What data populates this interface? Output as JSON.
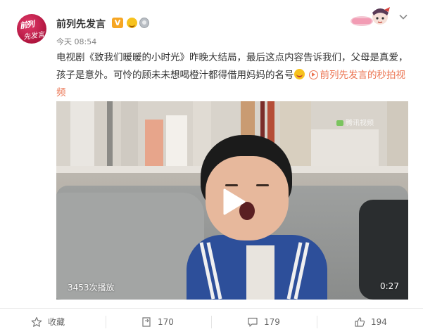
{
  "post": {
    "username": "前列先发言",
    "verified_badge": "V",
    "time": "今天 08:54",
    "text_before_link": "电视剧《致我们暖暖的小时光》昨晚大结局，最后这点内容告诉我们，父母是真爱，孩子是意外。可怜的顾未未想喝橙汁都得借用妈妈的名号",
    "video_link_label": "前列先发言的秒拍视频",
    "avatar_logo_lines": [
      "前列",
      "先发言"
    ],
    "emoji_face": "smile-face-icon"
  },
  "video": {
    "play_count": "3453次播放",
    "duration": "0:27",
    "watermark": "腾讯视频"
  },
  "actions": {
    "favorite_label": "收藏",
    "repost_count": "170",
    "comment_count": "179",
    "like_count": "194"
  },
  "colors": {
    "link": "#eb7350",
    "badge": "#f6a623",
    "avatar": "#c8184a"
  }
}
